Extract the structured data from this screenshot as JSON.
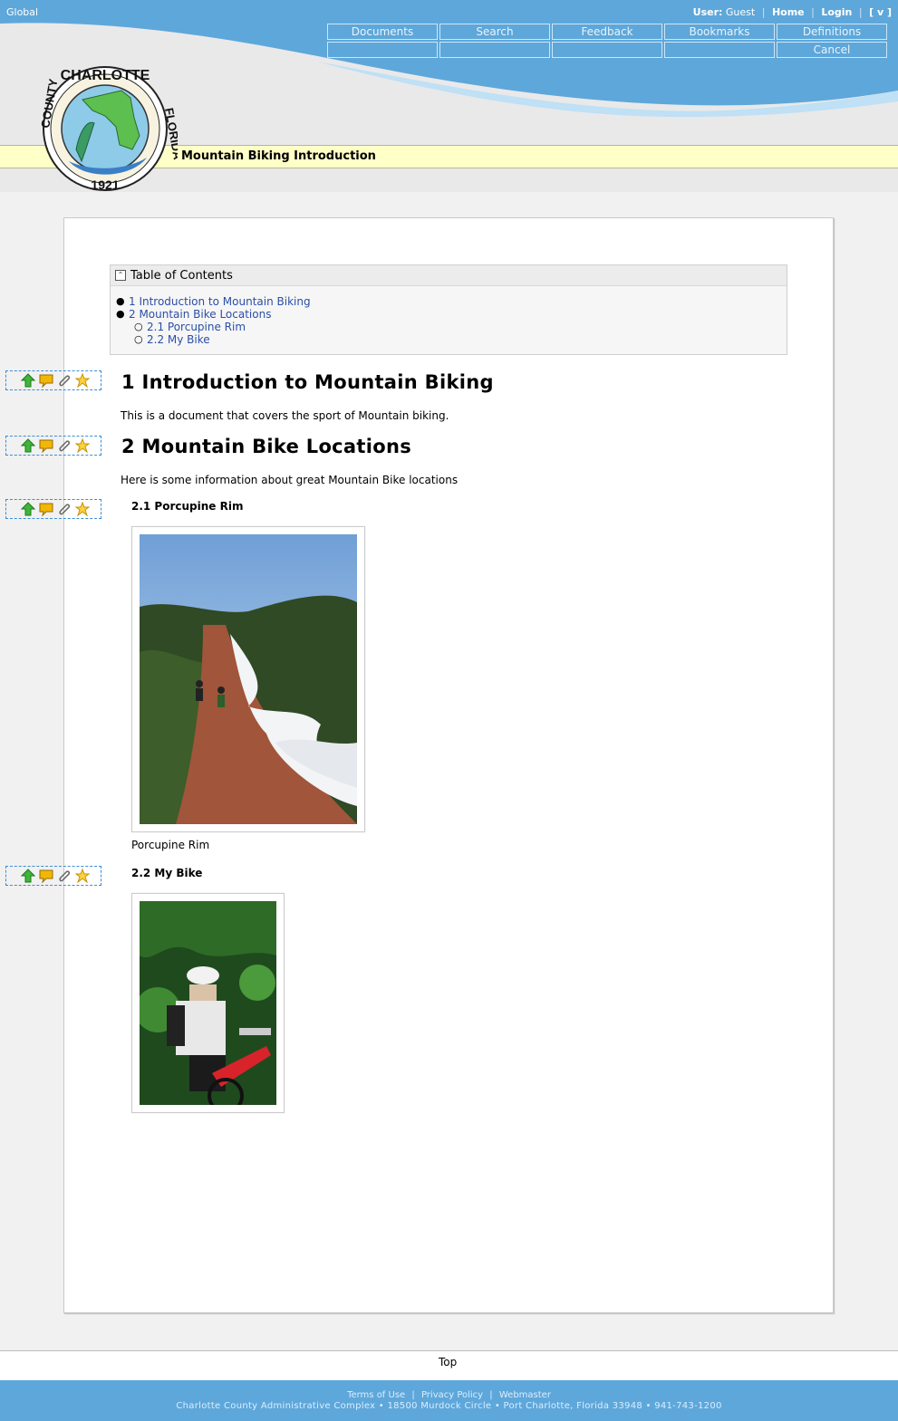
{
  "topbar": {
    "scope": "Global",
    "user_label": "User:",
    "user_name": "Guest",
    "home": "Home",
    "login": "Login",
    "toggle": "[ v ]"
  },
  "nav": {
    "documents": "Documents",
    "search": "Search",
    "feedback": "Feedback",
    "bookmarks": "Bookmarks",
    "definitions": "Definitions",
    "cancel": "Cancel"
  },
  "logo": {
    "top_text": "CHARLOTTE",
    "left_text": "COUNTY",
    "right_text": "FLORIDA",
    "year": "1921"
  },
  "page_title": "Mountain Biking Introduction",
  "toc": {
    "title": "Table of Contents",
    "items": [
      {
        "label": "1 Introduction to Mountain Biking"
      },
      {
        "label": "2 Mountain Bike Locations"
      }
    ],
    "subitems": [
      {
        "label": "2.1 Porcupine Rim"
      },
      {
        "label": "2.2 My Bike"
      }
    ]
  },
  "sections": {
    "s1_title": "1 Introduction to Mountain Biking",
    "s1_text": "This is a document that covers the sport of Mountain biking.",
    "s2_title": "2 Mountain Bike Locations",
    "s2_text": "Here is some information about great Mountain Bike locations",
    "s21_title": "2.1 Porcupine Rim",
    "s21_caption": "Porcupine Rim",
    "s22_title": "2.2 My Bike"
  },
  "bottom": {
    "top_link": "Top"
  },
  "footer": {
    "terms": "Terms of Use",
    "privacy": "Privacy Policy",
    "webmaster": "Webmaster",
    "sep": "|",
    "address": "Charlotte County Administrative Complex • 18500 Murdock Circle • Port Charlotte, Florida 33948 • 941-743-1200"
  },
  "colors": {
    "header_blue": "#5ea7da",
    "title_yellow": "#ffffc8",
    "link_blue": "#2b4fa5"
  },
  "icons": [
    "arrow-up-icon",
    "comment-icon",
    "paperclip-icon",
    "star-icon",
    "collapse-icon"
  ]
}
